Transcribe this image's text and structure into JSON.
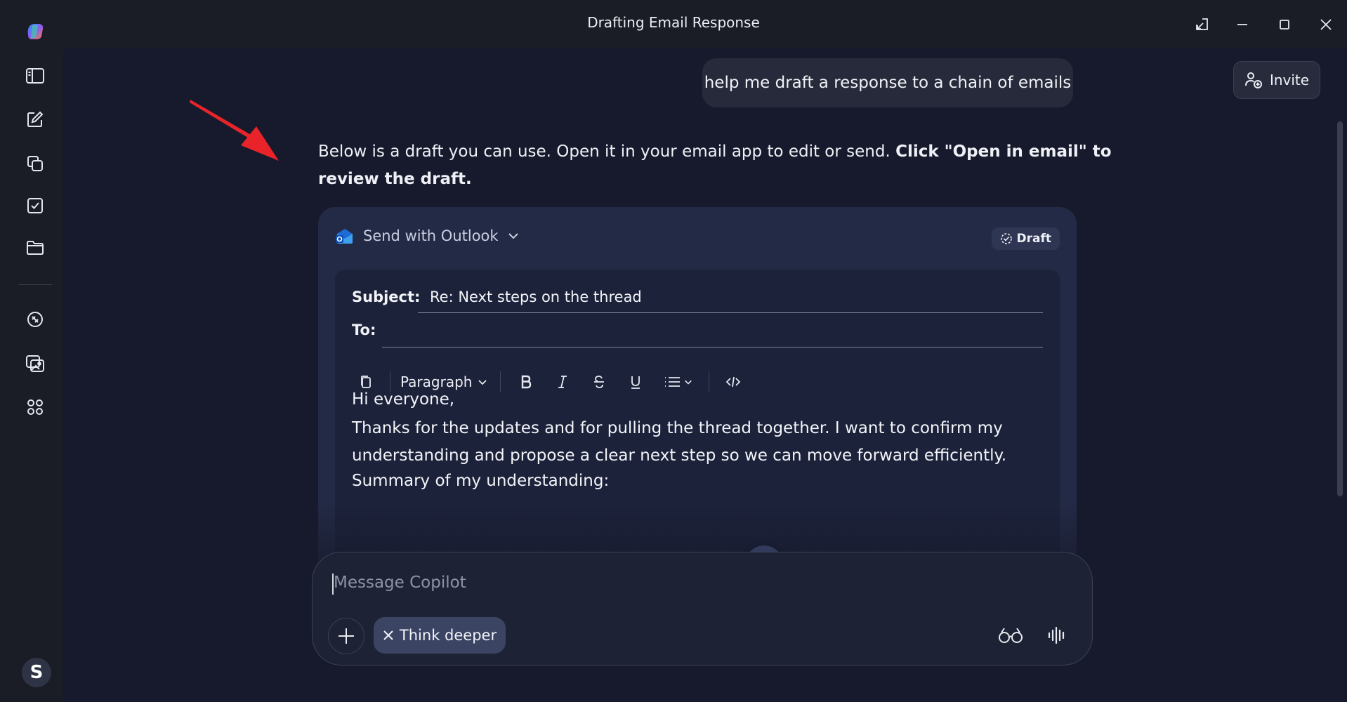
{
  "window": {
    "title": "Drafting Email Response"
  },
  "sidebar": {
    "items": [
      {
        "icon": "sidebar-panel-icon"
      },
      {
        "icon": "new-chat-icon"
      },
      {
        "icon": "pages-icon"
      },
      {
        "icon": "tasks-icon"
      },
      {
        "icon": "folder-icon"
      },
      {
        "icon": "discover-icon"
      },
      {
        "icon": "images-icon"
      },
      {
        "icon": "apps-icon"
      }
    ],
    "avatar_initial": "S"
  },
  "header": {
    "invite_label": "Invite"
  },
  "conversation": {
    "user_message": "help me draft a response to a chain of emails",
    "reply_intro": "Below is a draft you can use. Open it in your email app to edit or send. ",
    "reply_bold": "Click \"Open in email\" to review the draft."
  },
  "draft": {
    "send_with_label": "Send with Outlook",
    "badge_label": "Draft",
    "subject_label": "Subject:",
    "subject_value": "Re: Next steps on the thread",
    "to_label": "To:",
    "toolbar": {
      "paragraph_label": "Paragraph"
    },
    "body": {
      "greeting": "Hi everyone,",
      "paragraph1": "Thanks for the updates and for pulling the thread together. I want to confirm my understanding and propose a clear next step so we can move forward efficiently.",
      "summary_heading": "Summary of my understanding:"
    }
  },
  "composer": {
    "placeholder": "Message Copilot",
    "think_deeper_label": "Think deeper"
  },
  "colors": {
    "accent_arrow": "#e8242a",
    "background": "#171a2c",
    "card": "#232a45"
  }
}
